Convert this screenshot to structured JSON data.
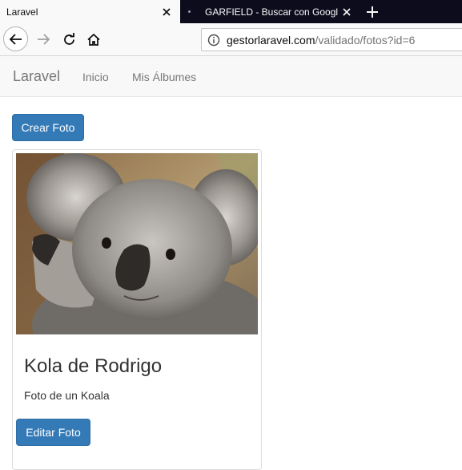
{
  "browser": {
    "tabs": [
      {
        "title": "Laravel",
        "active": true
      },
      {
        "title": "GARFIELD - Buscar con Google",
        "active": false
      }
    ],
    "url": {
      "host": "gestorlaravel.com",
      "path": "/validado/fotos?id=6"
    }
  },
  "navbar": {
    "brand": "Laravel",
    "links": [
      "Inicio",
      "Mis Álbumes"
    ]
  },
  "main": {
    "create_button": "Crear Foto",
    "photo": {
      "title": "Kola de Rodrigo",
      "description": "Foto de un Koala",
      "edit_button": "Editar Foto"
    }
  },
  "colors": {
    "primary": "#337ab7",
    "tabstrip": "#0c0c1d",
    "navbar_bg": "#f8f8f8"
  }
}
